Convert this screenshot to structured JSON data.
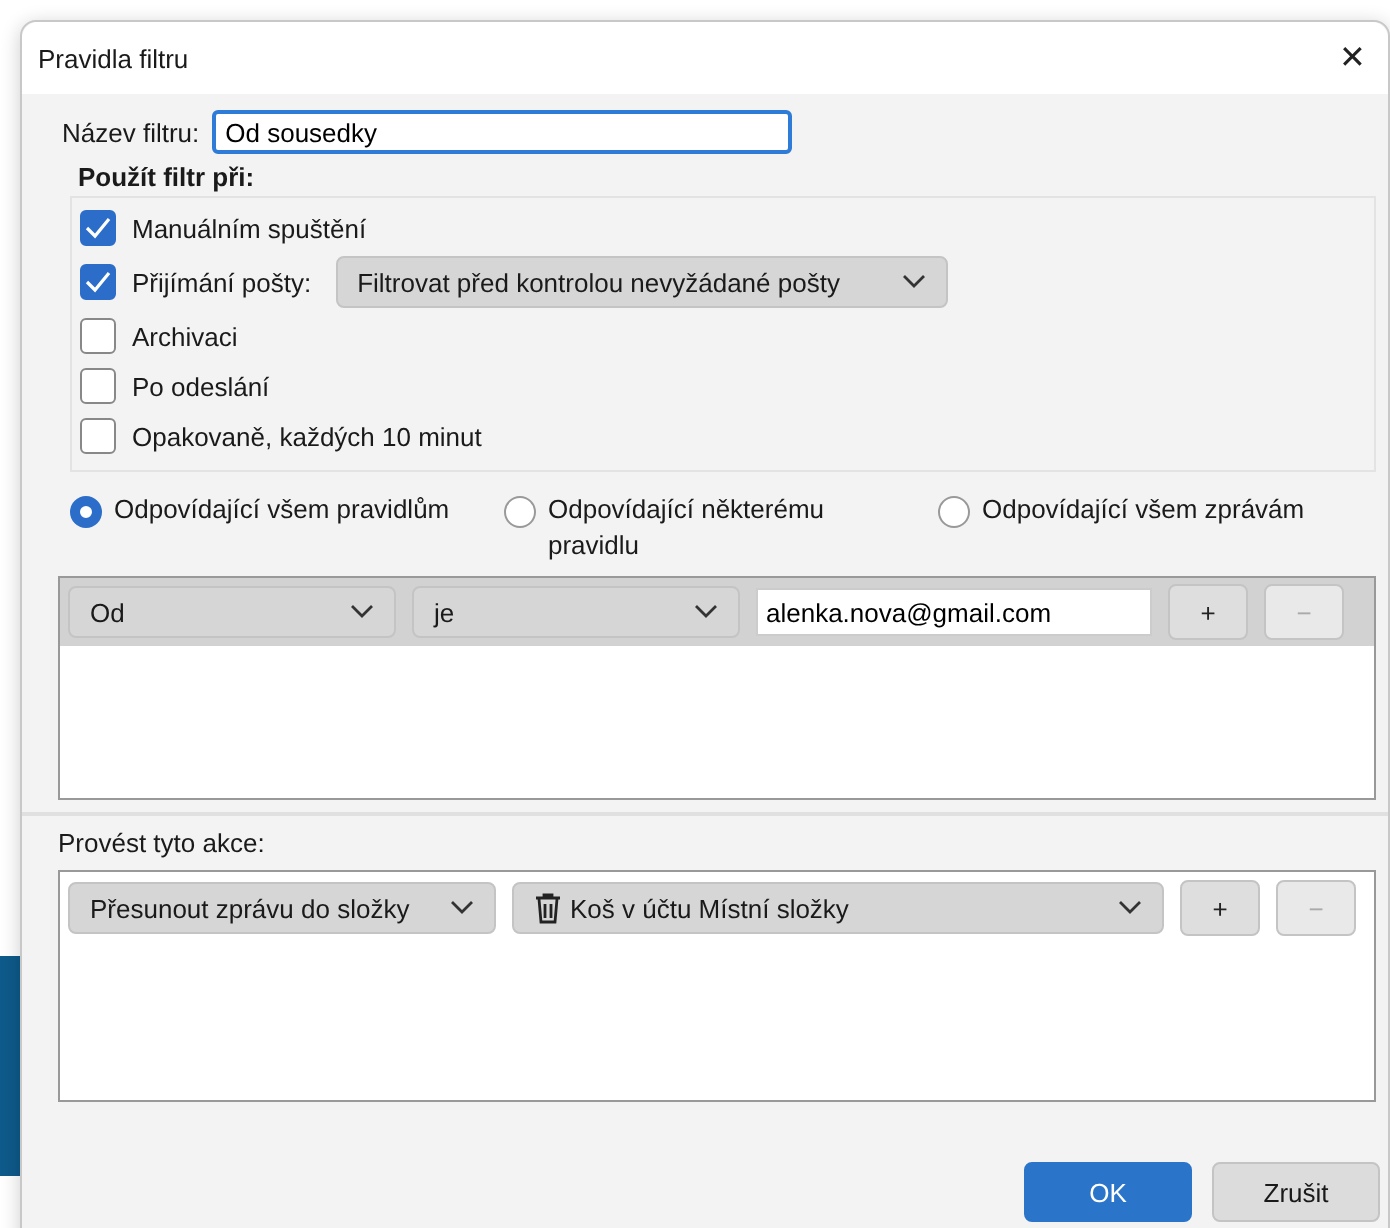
{
  "window": {
    "title": "Pravidla filtru",
    "close": "✕"
  },
  "filter_name": {
    "label": "Název filtru:",
    "value": "Od sousedky"
  },
  "apply_when": {
    "heading": "Použít filtr při:",
    "options": [
      {
        "kind": "check",
        "label": "Manuálním spuštění",
        "checked": true
      },
      {
        "kind": "check_select",
        "label": "Přijímání pošty:",
        "checked": true,
        "select": "Filtrovat před kontrolou nevyžádané pošty"
      },
      {
        "kind": "check",
        "label": "Archivaci",
        "checked": false
      },
      {
        "kind": "check",
        "label": "Po odeslání",
        "checked": false
      },
      {
        "kind": "check",
        "label": "Opakovaně, každých 10 minut",
        "checked": false
      }
    ]
  },
  "match": [
    {
      "label": "Odpovídající všem pravidlům",
      "selected": true
    },
    {
      "label": "Odpovídající některému pravidlu",
      "selected": false
    },
    {
      "label": "Odpovídající všem zprávám",
      "selected": false
    }
  ],
  "rules": [
    {
      "field": "Od",
      "operator": "je",
      "value": "alenka.nova@gmail.com",
      "add": "+",
      "remove": "−",
      "remove_disabled": true
    }
  ],
  "actions": {
    "label": "Provést tyto akce:",
    "rows": [
      {
        "action": "Přesunout zprávu do složky",
        "target": "Koš v účtu Místní složky",
        "add": "+",
        "remove": "−",
        "remove_disabled": true
      }
    ]
  },
  "buttons": [
    {
      "label": "OK",
      "kind": "primary"
    },
    {
      "label": "Zrušit",
      "kind": "secondary"
    }
  ]
}
